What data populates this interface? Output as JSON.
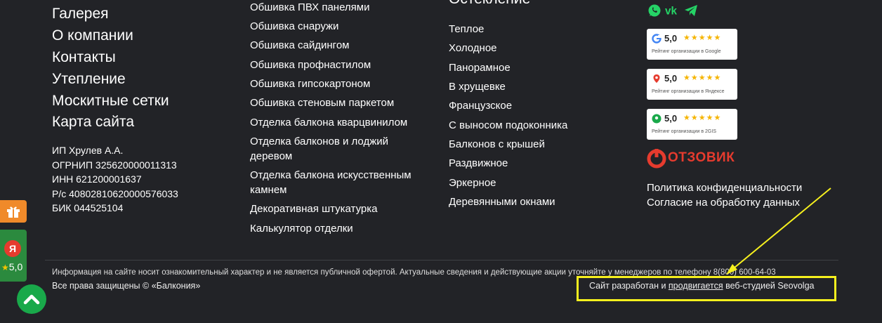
{
  "nav": {
    "main_links": [
      "Галерея",
      "О компании",
      "Контакты",
      "Утепление",
      "Москитные сетки",
      "Карта сайта"
    ],
    "legal_lines": [
      "ИП Хрулев А.А.",
      "ОГРНИП 325620000011313",
      "ИНН 621200001637",
      "Р/с 40802810620000576033",
      "БИК 044525104"
    ]
  },
  "finishing": {
    "links": [
      "Обшивка ПВХ панелями",
      "Обшивка снаружи",
      "Обшивка сайдингом",
      "Обшивка профнастилом",
      "Обшивка гипсокартоном",
      "Обшивка стеновым паркетом",
      "Отделка балкона кварцвинилом",
      "Отделка балконов и лоджий деревом",
      "Отделка балкона искусственным камнем",
      "Декоративная штукатурка",
      "Калькулятор отделки"
    ]
  },
  "glazing": {
    "heading": "Остекление",
    "links": [
      "Теплое",
      "Холодное",
      "Панорамное",
      "В хрущевке",
      "Французское",
      "С выносом подоконника",
      "Балконов с крышей",
      "Раздвижное",
      "Эркерное",
      "Деревянными окнами"
    ]
  },
  "social": {
    "icons": [
      "whatsapp-icon",
      "vk-icon",
      "telegram-icon"
    ]
  },
  "ratings": [
    {
      "score": "5,0",
      "caption": "Рейтинг организации в Google",
      "color": "#4285f4"
    },
    {
      "score": "5,0",
      "caption": "Рейтинг организации в Яндексе",
      "color": "#e63b2e"
    },
    {
      "score": "5,0",
      "caption": "Рейтинг организации в 2GIS",
      "color": "#19a94a"
    }
  ],
  "otzovik": {
    "label": "ОТЗОВИК"
  },
  "policy": {
    "privacy": "Политика конфиденциальности",
    "consent": "Согласие на обработку данных"
  },
  "footer": {
    "info": "Информация на сайте носит ознакомительный характер и не является публичной офертой. Актуальные сведения и действующие акции уточняйте у менеджеров по телефону 8(800) 600-64-03",
    "rights": "Все права защищены © «Балкония»",
    "dev_prefix": "Сайт разработан и ",
    "dev_link": "продвигается",
    "dev_suffix": " веб-студией Seovolga"
  },
  "widgets": {
    "yandex_letter": "Я",
    "yandex_rating": "5,0"
  },
  "colors": {
    "background": "#222327",
    "accent_yellow": "#f6f01e",
    "otzovik_red": "#e63b2e",
    "up_green": "#19a94a"
  }
}
